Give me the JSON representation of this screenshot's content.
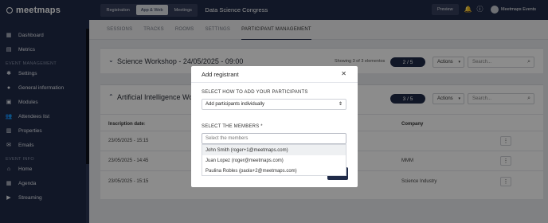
{
  "brand": {
    "name": "meetmaps"
  },
  "sidebar": {
    "items": [
      {
        "label": "Dashboard",
        "icon": "dashboard-icon"
      },
      {
        "label": "Metrics",
        "icon": "metrics-icon"
      }
    ],
    "section_event_management": "EVENT MANAGEMENT",
    "management_items": [
      {
        "label": "Settings",
        "icon": "gear-icon"
      },
      {
        "label": "General information",
        "icon": "info-icon"
      },
      {
        "label": "Modules",
        "icon": "modules-icon"
      },
      {
        "label": "Attendees list",
        "icon": "users-icon"
      },
      {
        "label": "Properties",
        "icon": "properties-icon"
      },
      {
        "label": "Emails",
        "icon": "mail-icon"
      }
    ],
    "section_event_info": "EVENT INFO",
    "info_items": [
      {
        "label": "Home",
        "icon": "home-icon"
      },
      {
        "label": "Agenda",
        "icon": "agenda-icon"
      },
      {
        "label": "Streaming",
        "icon": "streaming-icon"
      }
    ]
  },
  "topbar": {
    "tabs": [
      "Registration",
      "App & Web",
      "Meetings"
    ],
    "active_tab": "App & Web",
    "event_title": "Data Science Congress",
    "preview_label": "Preview",
    "user_name": "Meetmaps Events"
  },
  "subtabs": [
    "SESSIONS",
    "TRACKS",
    "ROOMS",
    "SETTINGS",
    "PARTICIPANT MANAGEMENT"
  ],
  "panel1": {
    "title": "Science Workshop - 24/05/2025 - 09:00",
    "showing": "Showing 3 of 3 elementos",
    "count": "2 / 5",
    "actions_label": "Actions",
    "search_placeholder": "Search..."
  },
  "panel2": {
    "title": "Artificial Intelligence Wo",
    "count": "3 / 5",
    "actions_label": "Actions",
    "search_placeholder": "Search...",
    "headers": {
      "inscription_date": "Inscription date",
      "company": "Company"
    },
    "rows": [
      {
        "date": "23/05/2025 - 15:15",
        "company": ""
      },
      {
        "date": "23/05/2025 - 14:45",
        "company": "MMM"
      },
      {
        "date": "23/05/2025 - 15:15",
        "company": "Science Industry"
      }
    ]
  },
  "modal": {
    "title": "Add registrant",
    "select_how_label": "SELECT HOW TO ADD YOUR PARTICIPANTS",
    "select_value": "Add participants individually",
    "members_label": "SELECT THE MEMBERS *",
    "members_placeholder": "Select the members",
    "options": [
      "John Smith (roger+1@meetmaps.com)",
      "Juan Lopez (roger@meetmaps.com)",
      "Paulina Robles (paola+2@meetmaps.com)"
    ]
  },
  "colors": {
    "navy": "#1f2a48",
    "background": "#e9ebee"
  }
}
